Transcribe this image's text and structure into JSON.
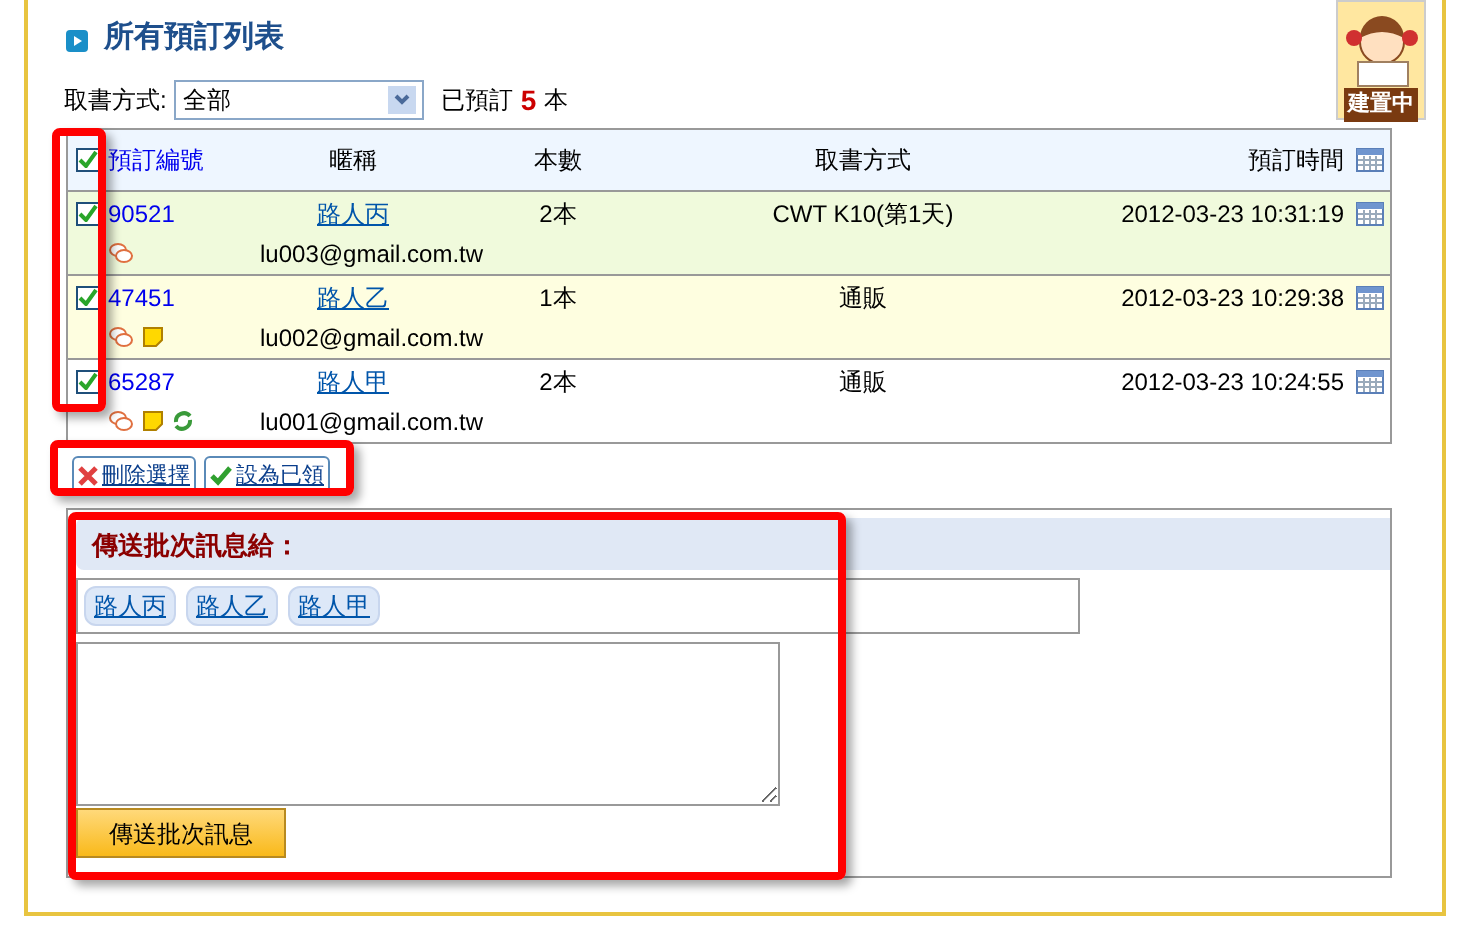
{
  "title": "所有預訂列表",
  "badge": {
    "text": "建置中"
  },
  "filter": {
    "label": "取書方式:",
    "value": "全部",
    "summary_prefix": "已預訂",
    "count": "5",
    "summary_suffix": "本"
  },
  "table": {
    "select_all_checked": true,
    "columns": [
      "預訂編號",
      "暱稱",
      "本數",
      "取書方式",
      "預訂時間"
    ],
    "rows": [
      {
        "checked": true,
        "id": "90521",
        "nickname": "路人丙",
        "count": "2本",
        "method": "CWT K10(第1天)",
        "time": "2012-03-23 10:31:19",
        "email": "lu003@gmail.com.tw",
        "color": "#f0fadc",
        "has_note": false,
        "has_renewal": false
      },
      {
        "checked": true,
        "id": "47451",
        "nickname": "路人乙",
        "count": "1本",
        "method": "通販",
        "time": "2012-03-23 10:29:38",
        "email": "lu002@gmail.com.tw",
        "color": "#fefee0",
        "has_note": true,
        "has_renewal": false
      },
      {
        "checked": true,
        "id": "65287",
        "nickname": "路人甲",
        "count": "2本",
        "method": "通販",
        "time": "2012-03-23 10:24:55",
        "email": "lu001@gmail.com.tw",
        "color": "#ffffff",
        "has_note": true,
        "has_renewal": true
      }
    ]
  },
  "actions": [
    {
      "kind": "delete",
      "label": "刪除選擇"
    },
    {
      "kind": "done",
      "label": "設為已領"
    }
  ],
  "message": {
    "heading": "傳送批次訊息給：",
    "recipients": [
      "路人丙",
      "路人乙",
      "路人甲"
    ],
    "send_button": "傳送批次訊息"
  }
}
